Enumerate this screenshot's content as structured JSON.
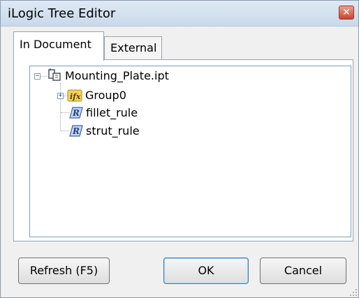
{
  "window": {
    "title": "iLogic Tree Editor"
  },
  "tabs": [
    {
      "label": "In Document",
      "active": true
    },
    {
      "label": "External",
      "active": false
    }
  ],
  "tree": {
    "root": {
      "label": "Mounting_Plate.ipt",
      "icon": "part-document-icon",
      "expanded": true
    },
    "children": [
      {
        "label": "Group0",
        "icon": "ifx-group-icon",
        "expandable": true,
        "expanded": false
      },
      {
        "label": "fillet_rule",
        "icon": "rule-icon"
      },
      {
        "label": "strut_rule",
        "icon": "rule-icon"
      }
    ]
  },
  "buttons": {
    "refresh": "Refresh (F5)",
    "ok": "OK",
    "cancel": "Cancel"
  },
  "colors": {
    "close_button": "#c7472f",
    "title_bar": "#dfe9f5",
    "tree_border": "#7f9db9",
    "rule_icon": "#3a5fa6",
    "ifx_icon": "#e8c440"
  }
}
